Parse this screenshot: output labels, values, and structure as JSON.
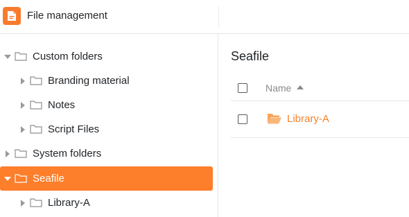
{
  "header": {
    "title": "File management"
  },
  "sidebar": {
    "items": [
      {
        "label": "Custom folders",
        "state": "expanded"
      },
      {
        "label": "Branding material",
        "state": "collapsed"
      },
      {
        "label": "Notes",
        "state": "collapsed"
      },
      {
        "label": "Script Files",
        "state": "collapsed"
      },
      {
        "label": "System folders",
        "state": "collapsed"
      },
      {
        "label": "Seafile",
        "state": "expanded",
        "selected": true
      },
      {
        "label": "Library-A",
        "state": "collapsed"
      }
    ]
  },
  "main": {
    "title": "Seafile",
    "table": {
      "column_name": "Name",
      "sort": "ascending",
      "rows": [
        {
          "name": "Library-A",
          "icon": "folder-open-icon"
        }
      ]
    }
  },
  "colors": {
    "accent": "#fd7e2b",
    "link": "#f5822a"
  }
}
